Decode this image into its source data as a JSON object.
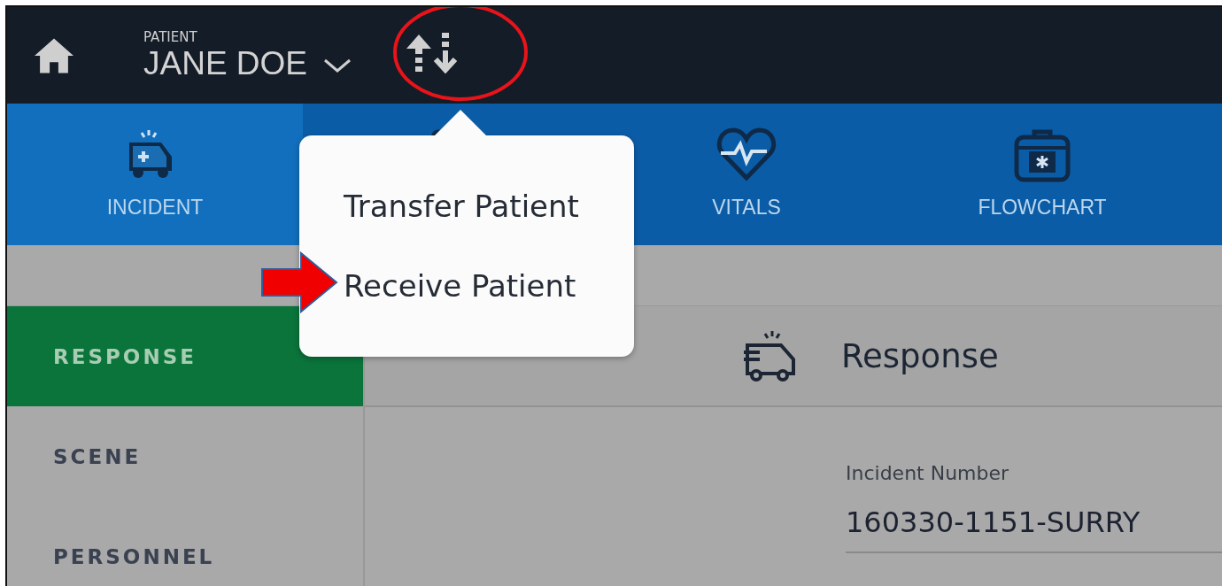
{
  "top_bar": {
    "patient_label": "PATIENT",
    "patient_name": "JANE DOE"
  },
  "tabs": [
    {
      "label": "INCIDENT",
      "kind": "ambulance",
      "selected": true
    },
    {
      "kind": "clipboard",
      "selected": false
    },
    {
      "label": "VITALS",
      "kind": "heart",
      "selected": false
    },
    {
      "label": "FLOWCHART",
      "kind": "kit",
      "selected": false
    }
  ],
  "popup_menu": {
    "items": [
      "Transfer Patient",
      "Receive Patient"
    ]
  },
  "sidebar": {
    "items": [
      {
        "label": "RESPONSE",
        "selected": true
      },
      {
        "label": "SCENE",
        "selected": false
      },
      {
        "label": "PERSONNEL",
        "selected": false
      }
    ]
  },
  "section": {
    "title": "Response",
    "fields": [
      {
        "label": "Incident Number",
        "value": "160330-1151-SURRY"
      }
    ]
  }
}
